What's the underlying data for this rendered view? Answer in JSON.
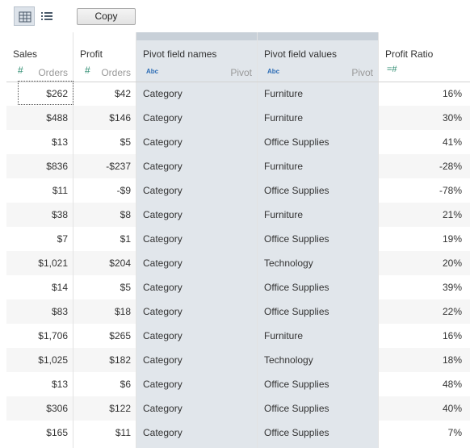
{
  "toolbar": {
    "copy_label": "Copy"
  },
  "columns": {
    "sales": {
      "name": "Sales",
      "type_icon": "#",
      "sub": "Orders"
    },
    "profit": {
      "name": "Profit",
      "type_icon": "#",
      "sub": "Orders"
    },
    "pivot_names": {
      "name": "Pivot field names",
      "type_icon": "Abc",
      "sub": "Pivot"
    },
    "pivot_values": {
      "name": "Pivot field values",
      "type_icon": "Abc",
      "sub": "Pivot"
    },
    "profit_ratio": {
      "name": "Profit Ratio",
      "type_icon": "=#"
    }
  },
  "rows": [
    [
      "$262",
      "$42",
      "Category",
      "Furniture",
      "16%"
    ],
    [
      "$488",
      "$146",
      "Category",
      "Furniture",
      "30%"
    ],
    [
      "$13",
      "$5",
      "Category",
      "Office Supplies",
      "41%"
    ],
    [
      "$836",
      "-$237",
      "Category",
      "Furniture",
      "-28%"
    ],
    [
      "$11",
      "-$9",
      "Category",
      "Office Supplies",
      "-78%"
    ],
    [
      "$38",
      "$8",
      "Category",
      "Furniture",
      "21%"
    ],
    [
      "$7",
      "$1",
      "Category",
      "Office Supplies",
      "19%"
    ],
    [
      "$1,021",
      "$204",
      "Category",
      "Technology",
      "20%"
    ],
    [
      "$14",
      "$5",
      "Category",
      "Office Supplies",
      "39%"
    ],
    [
      "$83",
      "$18",
      "Category",
      "Office Supplies",
      "22%"
    ],
    [
      "$1,706",
      "$265",
      "Category",
      "Furniture",
      "16%"
    ],
    [
      "$1,025",
      "$182",
      "Category",
      "Technology",
      "18%"
    ],
    [
      "$13",
      "$6",
      "Category",
      "Office Supplies",
      "48%"
    ],
    [
      "$306",
      "$122",
      "Category",
      "Office Supplies",
      "40%"
    ],
    [
      "$165",
      "$11",
      "Category",
      "Office Supplies",
      "7%"
    ]
  ]
}
